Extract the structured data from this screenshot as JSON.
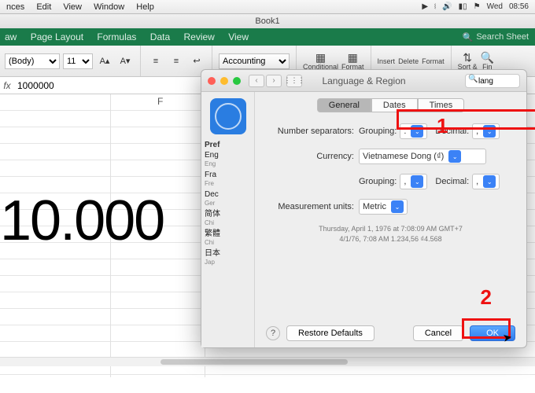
{
  "menubar": {
    "items": [
      "nces",
      "Edit",
      "View",
      "Window",
      "Help"
    ],
    "clock_day": "Wed",
    "clock_time": "08:56"
  },
  "titlebar": {
    "title": "Book1"
  },
  "ribbon_tabs": {
    "items": [
      "aw",
      "Page Layout",
      "Formulas",
      "Data",
      "Review",
      "View"
    ],
    "search_placeholder": "Search Sheet"
  },
  "ribbon": {
    "font_name": "(Body)",
    "font_size": "11",
    "number_format": "Accounting",
    "cond": "Conditional",
    "fmt": "Format",
    "insert": "Insert",
    "delete": "Delete",
    "format2": "Format",
    "sort": "Sort &",
    "fin": "Fin"
  },
  "formula_bar": {
    "fx": "fx",
    "value": "1000000"
  },
  "sheet": {
    "col": "F",
    "big": "10.000"
  },
  "dialog": {
    "title": "Language & Region",
    "search_value": "lang",
    "leftcol": {
      "hdr": "Pref",
      "langs": [
        {
          "t": "Eng",
          "s": "Eng"
        },
        {
          "t": "Fra",
          "s": "Fre"
        },
        {
          "t": "Dec",
          "s": "Ger"
        },
        {
          "t": "简体",
          "s": "Chi"
        },
        {
          "t": "繁體",
          "s": "Chi"
        },
        {
          "t": "日本",
          "s": "Jap"
        }
      ]
    },
    "tabs": {
      "general": "General",
      "dates": "Dates",
      "times": "Times"
    },
    "labels": {
      "numsep": "Number separators:",
      "grouping": "Grouping:",
      "decimal": "Decimal:",
      "currency": "Currency:",
      "measure": "Measurement units:"
    },
    "values": {
      "group1": ".",
      "dec1": ",",
      "currency": "Vietnamese Dong (₫)",
      "group2": ",",
      "dec2": ",",
      "measure": "Metric"
    },
    "sample_line1": "Thursday, April 1, 1976 at 7:08:09 AM GMT+7",
    "sample_line2": "4/1/76, 7:08 AM    1.234,56    ₫4.568",
    "buttons": {
      "restore": "Restore Defaults",
      "cancel": "Cancel",
      "ok": "OK"
    },
    "markers": {
      "one": "1",
      "two": "2"
    }
  }
}
